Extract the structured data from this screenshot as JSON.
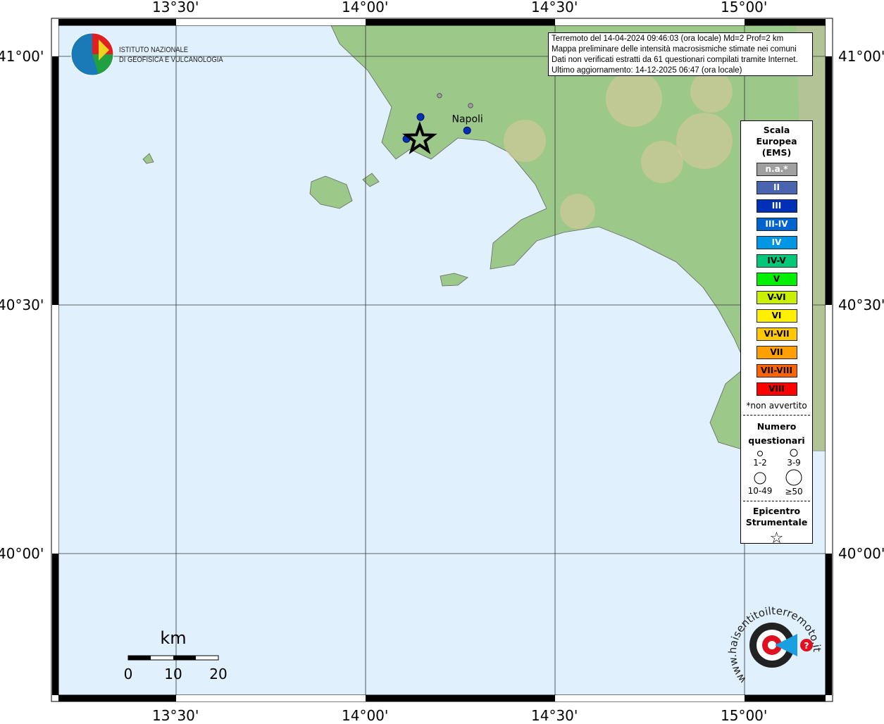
{
  "info": {
    "lines": [
      "Terremoto del 14-04-2024 09:46:03 (ora locale) Md=2 Prof=2 km",
      "Mappa preliminare delle intensità macrosismiche stimate nei comuni",
      "Dati non verificati estratti da 61 questionari compilati tramite Internet.",
      "Ultimo aggiornamento: 14-12-2025 06:47 (ora locale)"
    ]
  },
  "axes": {
    "lon_labels": [
      "13°30'",
      "14°00'",
      "14°30'",
      "15°00'"
    ],
    "lon_values": [
      13.5,
      14.0,
      14.5,
      15.0
    ],
    "lat_labels": [
      "41°00'",
      "40°30'",
      "40°00'"
    ],
    "lat_values": [
      41.0,
      40.5,
      40.0
    ]
  },
  "logo": {
    "name": "ISTITUTO NAZIONALE",
    "name2": "DI GEOFISICA E VULCANOLOGIA"
  },
  "legend": {
    "title": [
      "Scala",
      "Europea",
      "(EMS)"
    ],
    "items": [
      {
        "label": "n.a.*",
        "color": "#a0a0a0",
        "text": "#fff"
      },
      {
        "label": "II",
        "color": "#4a64b0",
        "text": "#fff"
      },
      {
        "label": "III",
        "color": "#0030b8",
        "text": "#fff"
      },
      {
        "label": "III-IV",
        "color": "#0064d0",
        "text": "#fff"
      },
      {
        "label": "IV",
        "color": "#0096e6",
        "text": "#fff"
      },
      {
        "label": "IV-V",
        "color": "#00c878",
        "text": "#000"
      },
      {
        "label": "V",
        "color": "#00f000",
        "text": "#000"
      },
      {
        "label": "V-VI",
        "color": "#c8f000",
        "text": "#000"
      },
      {
        "label": "VI",
        "color": "#fff000",
        "text": "#000"
      },
      {
        "label": "VI-VII",
        "color": "#ffc800",
        "text": "#000"
      },
      {
        "label": "VII",
        "color": "#ffa000",
        "text": "#000"
      },
      {
        "label": "VII-VIII",
        "color": "#ff6400",
        "text": "#000"
      },
      {
        "label": "VIII",
        "color": "#ff0000",
        "text": "#000"
      }
    ],
    "note": "*non avvertito",
    "q_title": [
      "Numero",
      "questionari"
    ],
    "q_sizes": [
      "1-2",
      "3-9",
      "10-49",
      "≥50"
    ],
    "epi_title": [
      "Epicentro",
      "Strumentale"
    ]
  },
  "places": [
    {
      "name": "Napoli",
      "lon": 14.25,
      "lat": 40.862
    }
  ],
  "epicenter": {
    "lon": 14.143,
    "lat": 40.833
  },
  "points": [
    {
      "lon": 14.145,
      "lat": 40.878,
      "intensity": "III",
      "size": "1-2"
    },
    {
      "lon": 14.108,
      "lat": 40.834,
      "intensity": "III",
      "size": "1-2"
    },
    {
      "lon": 14.268,
      "lat": 40.851,
      "intensity": "III",
      "size": "1-2"
    },
    {
      "lon": 14.195,
      "lat": 40.921,
      "intensity": "n.a.*",
      "size": "1-2"
    },
    {
      "lon": 14.277,
      "lat": 40.901,
      "intensity": "n.a.*",
      "size": "1-2"
    }
  ],
  "scale": {
    "unit": "km",
    "ticks": [
      "0",
      "10",
      "20"
    ]
  },
  "badge": {
    "text": "www.haisentitoilterremoto.it"
  },
  "colors": {
    "sea": "#e0f0fc",
    "land": "#9cc88a",
    "relief": "#d8c89a"
  }
}
